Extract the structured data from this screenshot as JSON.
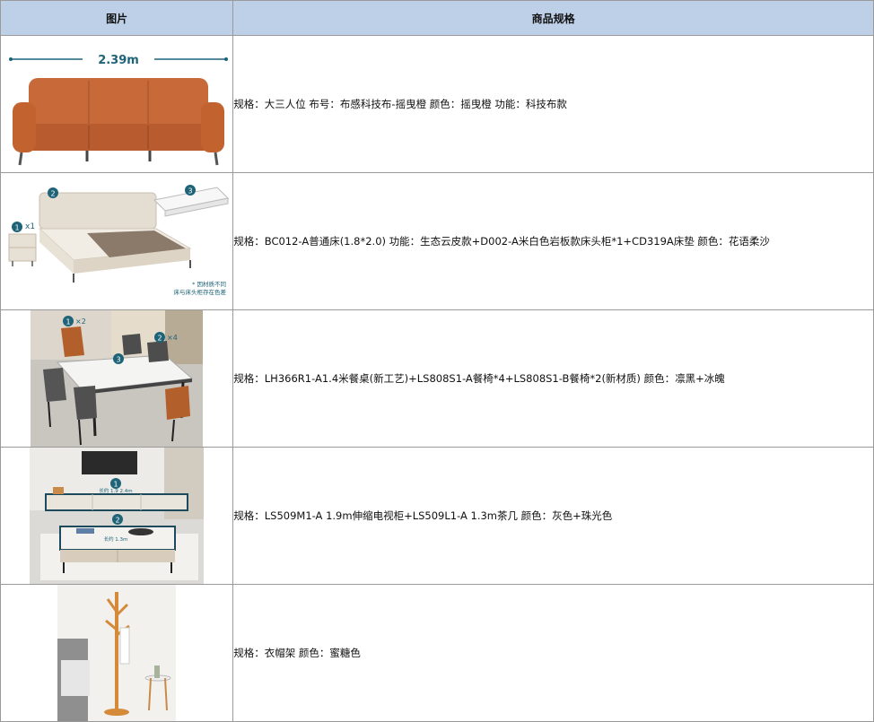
{
  "header": {
    "image_col": "图片",
    "spec_col": "商品规格"
  },
  "rows": [
    {
      "spec": "规格：大三人位 布号：布感科技布-摇曳橙 颜色：摇曳橙 功能：科技布款",
      "image": {
        "dimension": "2.39m",
        "colors": {
          "sofa": "#c8693a",
          "accent": "#1e6378"
        }
      }
    },
    {
      "spec": "规格：BC012-A普通床(1.8*2.0) 功能：生态云皮款+D002-A米白色岩板款床头柜*1+CD319A床垫 颜色：花语柔沙",
      "image": {
        "badges": [
          "1",
          "2",
          "3"
        ],
        "qty": "x1",
        "note_line1": "* 因材质不同",
        "note_line2": "床与床头柜存在色差"
      }
    },
    {
      "spec": "规格：LH366R1-A1.4米餐桌(新工艺)+LS808S1-A餐椅*4+LS808S1-B餐椅*2(新材质) 颜色：凛黑+冰魄",
      "image": {
        "badges": [
          "1",
          "2",
          "3"
        ],
        "qty1": "×2",
        "qty2": "×4"
      }
    },
    {
      "spec": "规格：LS509M1-A 1.9m伸缩电视柜+LS509L1-A 1.3m茶几 颜色：灰色+珠光色",
      "image": {
        "badges": [
          "1",
          "2"
        ],
        "len1": "长约 1.9 2.4m",
        "len2": "长约 1.3m"
      }
    },
    {
      "spec": "规格：衣帽架 颜色：蜜糖色",
      "image": {
        "colors": {
          "wood": "#d58a3a"
        }
      }
    }
  ]
}
